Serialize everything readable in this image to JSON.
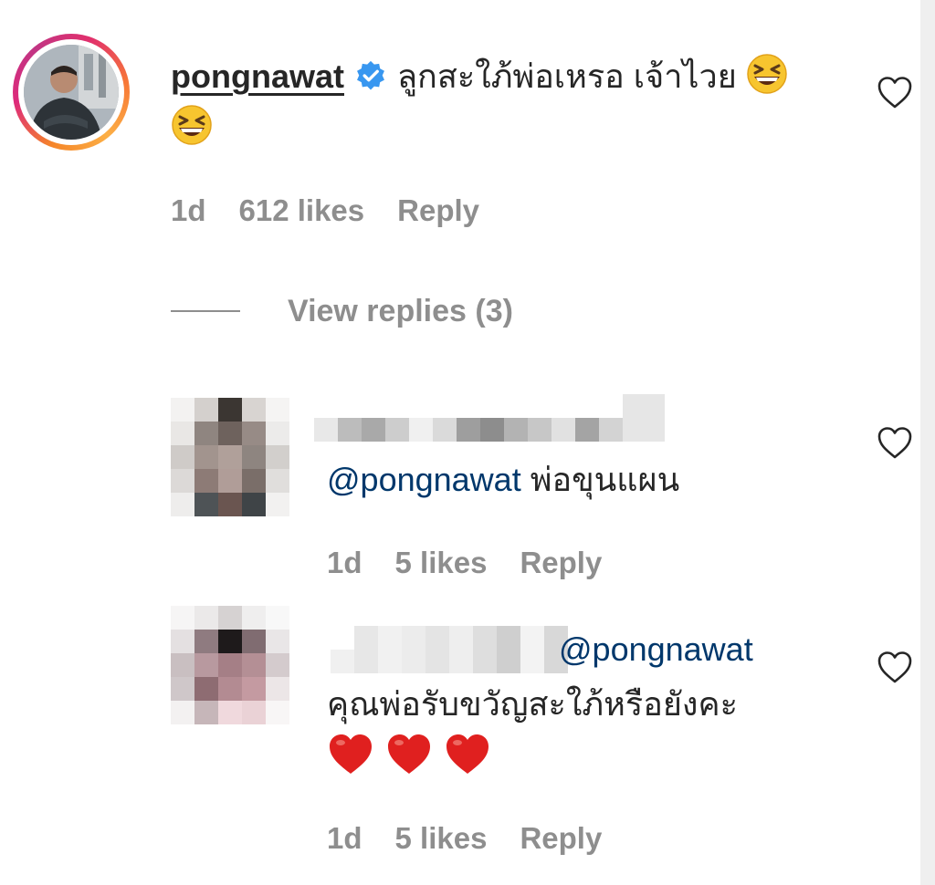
{
  "main_comment": {
    "username": "pongnawat",
    "verified_icon": "verified-badge-icon",
    "text": "ลูกสะใภ้พ่อเหรอ เจ้าไวย",
    "emojis": [
      "grinning-squinting-face",
      "grinning-squinting-face"
    ],
    "time": "1d",
    "likes": "612 likes",
    "reply": "Reply"
  },
  "view_replies": "View replies (3)",
  "replies": [
    {
      "mention": "@pongnawat",
      "text": "พ่อขุนแผน",
      "time": "1d",
      "likes": "5 likes",
      "reply": "Reply"
    },
    {
      "mention": "@pongnawat",
      "text": "คุณพ่อรับขวัญสะใภ้หรือยังคะ",
      "emojis": [
        "red-heart",
        "red-heart",
        "red-heart"
      ],
      "time": "1d",
      "likes": "5 likes",
      "reply": "Reply"
    }
  ],
  "icons": {
    "like": "heart-outline-icon"
  },
  "colors": {
    "text": "#262626",
    "meta": "#8e8e8e",
    "mention": "#00376b",
    "verified": "#3897f0",
    "heart": "#e0201f"
  }
}
